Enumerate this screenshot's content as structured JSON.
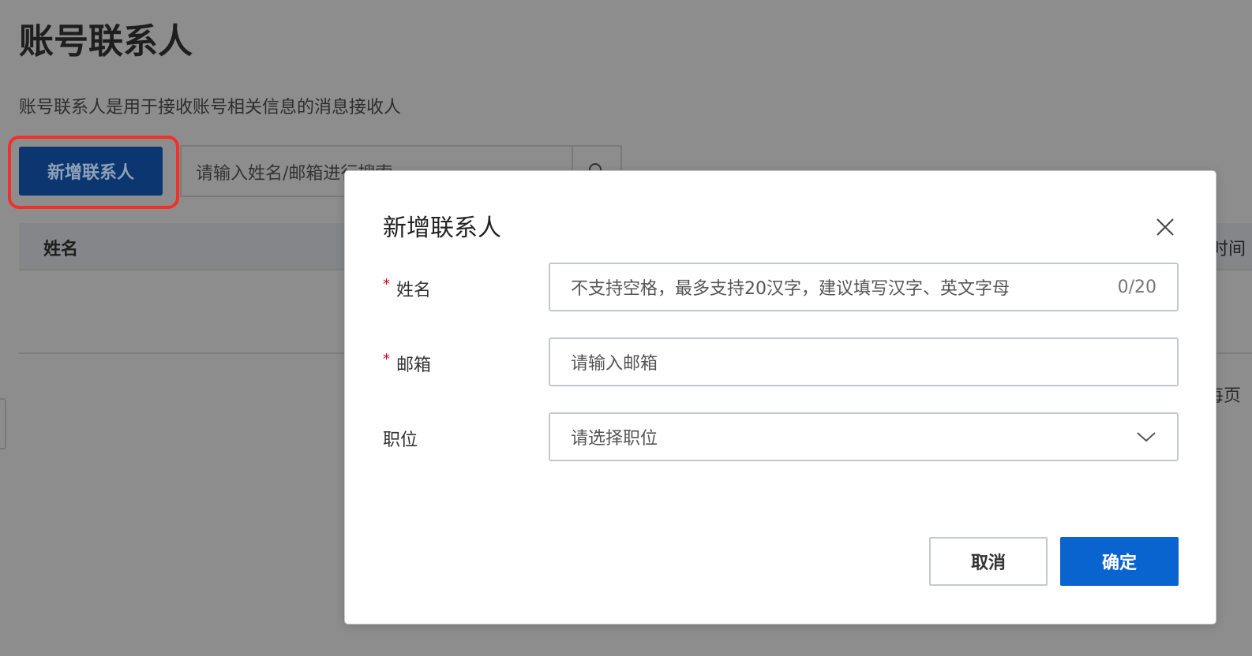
{
  "page": {
    "title": "账号联系人",
    "subtitle": "账号联系人是用于接收账号相关信息的消息接收人",
    "add_button": "新增联系人",
    "search_placeholder": "请输入姓名/邮箱进行搜索",
    "table_headers": {
      "name": "姓名",
      "time": "时间"
    },
    "pager_text": "每页"
  },
  "modal": {
    "title": "新增联系人",
    "fields": [
      {
        "label": "姓名",
        "required_mark": "*",
        "placeholder": "不支持空格，最多支持20汉字，建议填写汉字、英文字母",
        "counter": "0/20"
      },
      {
        "label": "邮箱",
        "required_mark": "*",
        "placeholder": "请输入邮箱"
      },
      {
        "label": "职位",
        "placeholder": "请选择职位"
      }
    ],
    "cancel": "取消",
    "confirm": "确定"
  },
  "colors": {
    "primary": "#0a64d0",
    "highlight": "#f2302a",
    "required": "#d0021b"
  }
}
